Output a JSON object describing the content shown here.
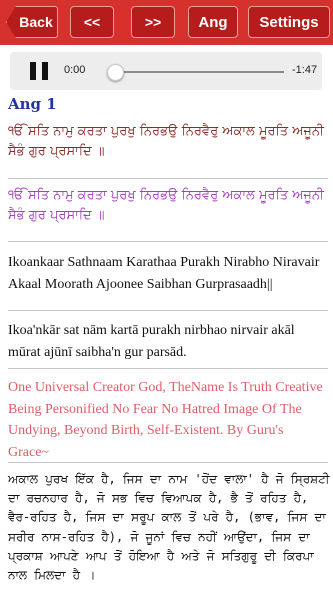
{
  "toolbar": {
    "back_label": "Back",
    "prev_label": "<<",
    "next_label": ">>",
    "ang_label": "Ang",
    "settings_label": "Settings"
  },
  "player": {
    "current_time": "0:00",
    "remaining_time": "-1:47",
    "progress": 0.0
  },
  "content": {
    "ang_title": "Ang 1",
    "gurmukhi_1": "ੴ ਸਤਿ ਨਾਮੁ ਕਰਤਾ ਪੁਰਖੁ ਨਿਰਭਉ ਨਿਰਵੈਰੁ ਅਕਾਲ ਮੂਰਤਿ ਅਜੂਨੀ ਸੈਭੰ ਗੁਰ ਪ੍ਰਸਾਦਿ ॥",
    "gurmukhi_2": "ੴ ਸਤਿ ਨਾਮੁ ਕਰਤਾ ਪੁਰਖੁ ਨਿਰਭਉ ਨਿਰਵੈਰੁ ਅਕਾਲ ਮੂਰਤਿ ਅਜੂਨੀ ਸੈਭੰ ਗੁਰ ਪ੍ਰਸਾਦਿ ॥",
    "transliteration_1": "Ikoankaar Sathnaam Karathaa Purakh Nirabho Niravair Akaal Moorath Ajoonee Saibhan Gurprasaadh||",
    "transliteration_2": "Ikoa'nkār sat nām kartā purakh nirbhao nirvair akāl mūrat ajūnī saibha'n gur parsād.",
    "english_translation": "One Universal Creator God, TheName Is Truth Creative Being Personified No Fear No Hatred Image Of The Undying, Beyond Birth, Self-Existent. By Guru's Grace~",
    "punjabi_explanation": "ਅਕਾਲ ਪੁਰਖ ਇੱਕ ਹੈ, ਜਿਸ ਦਾ ਨਾਮ 'ਹੋਂਦ ਵਾਲਾ' ਹੈ ਜੋ ਸ੍ਰਿਸ਼ਟੀ ਦਾ ਰਚਨਹਾਰ ਹੈ, ਜੋ ਸਭ ਵਿਚ ਵਿਆਪਕ ਹੈ, ਭੈ ਤੋਂ ਰਹਿਤ ਹੈ, ਵੈਰ-ਰਹਿਤ ਹੈ, ਜਿਸ ਦਾ ਸਰੂਪ ਕਾਲ ਤੋਂ ਪਰੇ ਹੈ, (ਭਾਵ, ਜਿਸ ਦਾ ਸਰੀਰ ਨਾਸ-ਰਹਿਤ ਹੈ), ਜੋ ਜੂਨਾਂ ਵਿਚ ਨਹੀਂ ਆਉਂਦਾ, ਜਿਸ ਦਾ ਪ੍ਰਕਾਸ਼ ਆਪਣੇ ਆਪ ਤੋਂ ਹੋਇਆ ਹੈ ਅਤੇ ਜੋ ਸਤਿਗੁਰੂ ਦੀ ਕਿਰਪਾ ਨਾਲ ਮਿਲਦਾ ਹੈ ।"
  },
  "colors": {
    "toolbar_bg": "#d6312c",
    "button_bg": "#b51c1b",
    "ang_title": "#2432a6",
    "gurmukhi_1": "#8c2b25",
    "gurmukhi_2": "#a63fbf",
    "english": "#e05d68"
  }
}
